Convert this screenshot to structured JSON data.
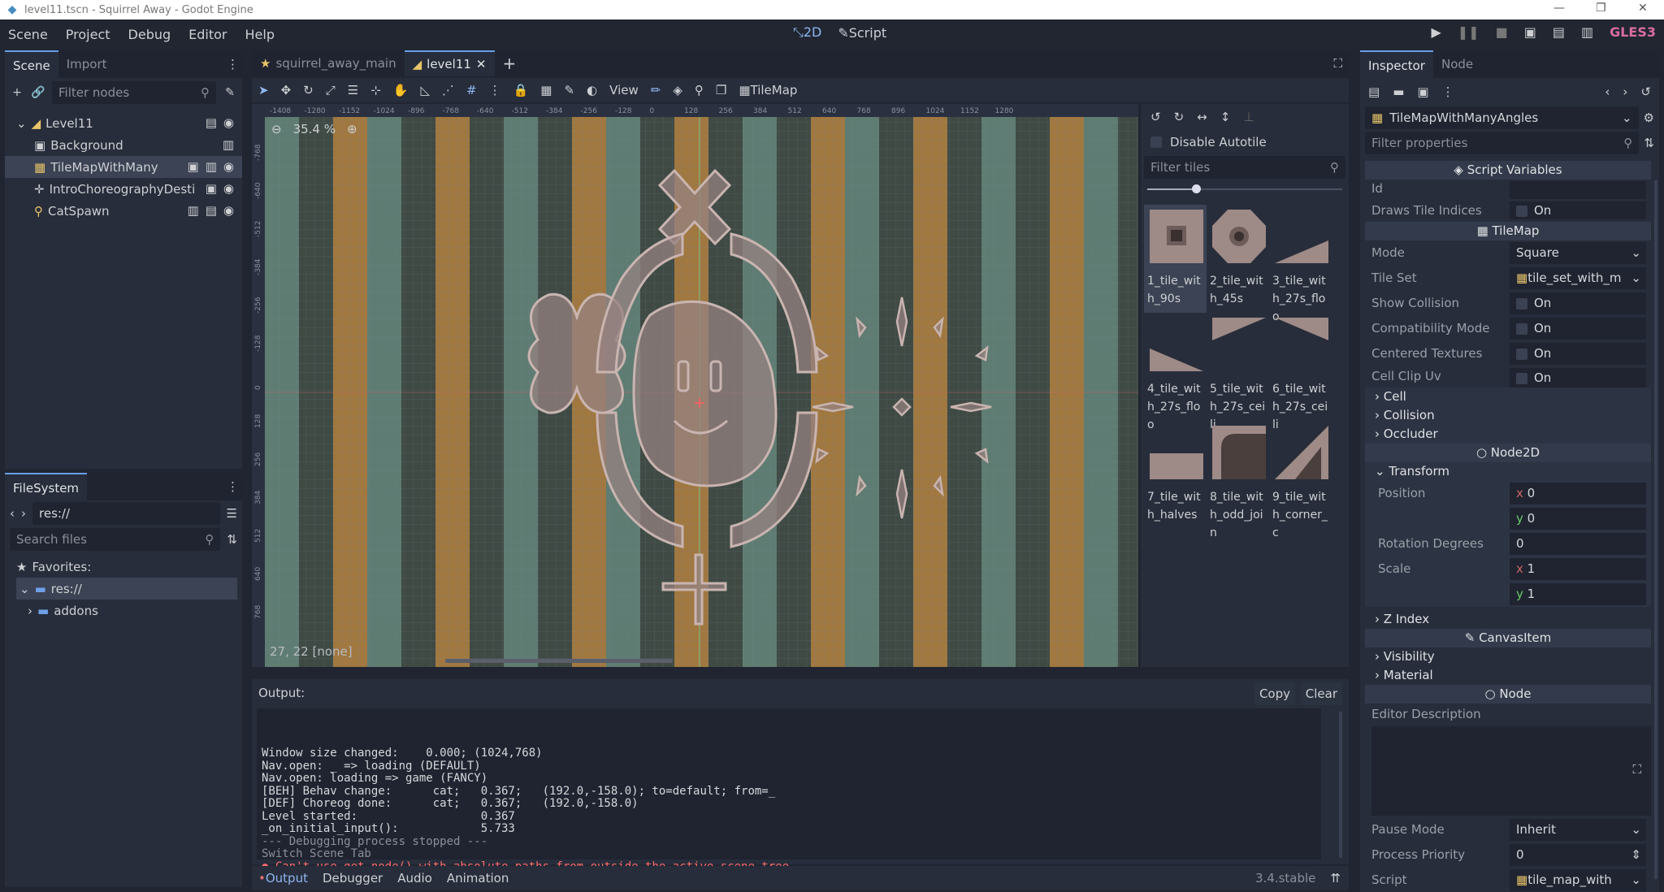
{
  "window": {
    "title": "level11.tscn - Squirrel Away - Godot Engine"
  },
  "menu": {
    "items": [
      "Scene",
      "Project",
      "Debug",
      "Editor",
      "Help"
    ],
    "workspace_2d": "2D",
    "workspace_script": "Script",
    "renderer": "GLES3"
  },
  "scene_dock": {
    "tabs": [
      "Scene",
      "Import"
    ],
    "filter_placeholder": "Filter nodes",
    "nodes": [
      "Level11",
      "Background",
      "TileMapWithMany",
      "IntroChoreographyDesti",
      "CatSpawn"
    ]
  },
  "filesystem": {
    "tab": "FileSystem",
    "path": "res://",
    "search_placeholder": "Search files",
    "favorites": "Favorites:",
    "items": [
      "res://",
      "addons"
    ]
  },
  "editor_tabs": [
    "squirrel_away_main",
    "level11"
  ],
  "toolbar": {
    "view": "View",
    "tilemap": "TileMap"
  },
  "viewport": {
    "zoom": "35.4 %",
    "status": "27, 22 [none]",
    "ruler_h": [
      "-1408",
      "-1280",
      "-1152",
      "-1024",
      "-896",
      "-768",
      "-640",
      "-512",
      "-384",
      "-256",
      "-128",
      "0",
      "128",
      "256",
      "384",
      "512",
      "640",
      "768",
      "896",
      "1024",
      "1152",
      "1280"
    ],
    "ruler_v": [
      "-768",
      "-640",
      "-512",
      "-384",
      "-256",
      "-128",
      "0",
      "128",
      "256",
      "384",
      "512",
      "640",
      "768"
    ]
  },
  "tile_palette": {
    "disable_autotile": "Disable Autotile",
    "filter_placeholder": "Filter tiles",
    "tiles": [
      "1_tile_with_90s",
      "2_tile_with_45s",
      "3_tile_with_27s_floo",
      "4_tile_with_27s_floo",
      "5_tile_with_27s_ceili",
      "6_tile_with_27s_ceili",
      "7_tile_with_halves",
      "8_tile_with_odd_join",
      "9_tile_with_corner_c"
    ]
  },
  "output": {
    "label": "Output:",
    "copy": "Copy",
    "clear": "Clear",
    "lines": [
      "Window size changed:    0.000; (1024,768)",
      "Nav.open: _ => loading (DEFAULT)",
      "Nav.open: loading => game (FANCY)",
      "[BEH] Behav change:      cat;   0.367;   (192.0,-158.0); to=default; from=_",
      "[DEF] Choreog done:      cat;   0.367;   (192.0,-158.0)",
      "Level started:                  0.367",
      "_on_initial_input():            5.733",
      "--- Debugging process stopped ---",
      "Switch Scene Tab"
    ],
    "error": "Can't use get_node() with absolute paths from outside the active scene tree."
  },
  "bottom_tabs": [
    "Output",
    "Debugger",
    "Audio",
    "Animation"
  ],
  "version": "3.4.stable",
  "inspector": {
    "tabs": [
      "Inspector",
      "Node"
    ],
    "node_name": "TileMapWithManyAngles",
    "filter_placeholder": "Filter properties",
    "script_vars": "Script Variables",
    "id_label": "Id",
    "draws_tile_indices": "Draws Tile Indices",
    "tilemap_section": "TileMap",
    "props": [
      {
        "k": "Mode",
        "v": "Square"
      },
      {
        "k": "Tile Set",
        "v": "tile_set_with_m"
      },
      {
        "k": "Show Collision",
        "v": "On"
      },
      {
        "k": "Compatibility Mode",
        "v": "On"
      },
      {
        "k": "Centered Textures",
        "v": "On"
      },
      {
        "k": "Cell Clip Uv",
        "v": "On"
      }
    ],
    "on": "On",
    "groups": [
      "Cell",
      "Collision",
      "Occluder"
    ],
    "node2d": "Node2D",
    "transform": "Transform",
    "position": "Position",
    "pos_x": "0",
    "pos_y": "0",
    "rotation": "Rotation Degrees",
    "rotation_v": "0",
    "scale": "Scale",
    "scale_x": "1",
    "scale_y": "1",
    "zindex": "Z Index",
    "canvasitem": "CanvasItem",
    "visibility": "Visibility",
    "material": "Material",
    "node": "Node",
    "editor_desc": "Editor Description",
    "pause_mode": "Pause Mode",
    "pause_v": "Inherit",
    "priority": "Process Priority",
    "priority_v": "0",
    "script": "Script",
    "script_v": "tile_map_with"
  }
}
